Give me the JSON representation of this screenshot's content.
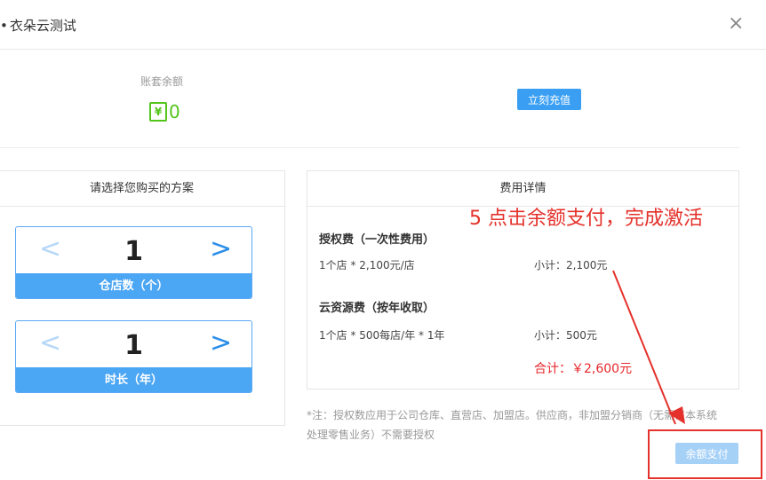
{
  "dialog": {
    "title": "衣朵云测试",
    "close_glyph": "×"
  },
  "balance": {
    "label": "账套余额",
    "currency_glyph": "¥",
    "value": "0",
    "recharge_label": "立刻充值"
  },
  "plan": {
    "title": "请选择您购买的方案",
    "steppers": [
      {
        "value": "1",
        "caption": "仓店数（个）"
      },
      {
        "value": "1",
        "caption": "时长（年）"
      }
    ]
  },
  "fees": {
    "title": "费用详情",
    "license_heading": "授权费（一次性费用）",
    "license_formula": "1个店 * 2,100元/店",
    "license_subtotal": "小计：2,100元",
    "cloud_heading": "云资源费（按年收取）",
    "cloud_formula": "1个店 * 500每店/年 * 1年",
    "cloud_subtotal": "小计：500元",
    "total": "合计：￥2,600元"
  },
  "note": "*注：授权数应用于公司仓库、直营店、加盟店。供应商，非加盟分销商（无需在本系统处理零售业务）不需要授权",
  "pay_button_label": "余额支付",
  "annotation": "5  点击余额支付，完成激活",
  "colors": {
    "accent": "#3a9ff3",
    "balance_green": "#52c41a",
    "annotation_red": "#e4312b"
  }
}
